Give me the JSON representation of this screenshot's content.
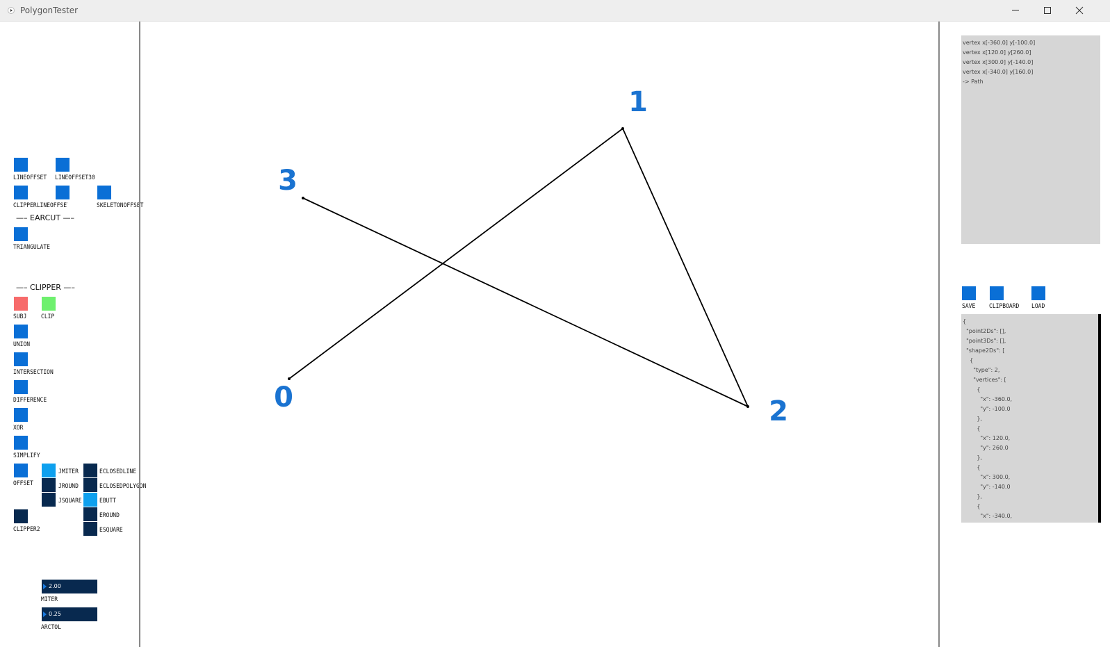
{
  "window": {
    "title": "PolygonTester"
  },
  "left": {
    "line_offset": "LINEOFFSET",
    "line_offset30": "LINEOFFSET30",
    "clipper_line_offset": "CLIPPERLINEOFFSET",
    "skeleton_offset": "SKELETONOFFSET",
    "earcut_header": "—– EARCUT —–",
    "triangulate": "TRIANGULATE",
    "clipper_header": "—– CLIPPER —–",
    "subj": "SUBJ",
    "clip": "CLIP",
    "union": "UNION",
    "intersection": "INTERSECTION",
    "difference": "DIFFERENCE",
    "xor": "XOR",
    "simplify": "SIMPLIFY",
    "offset": "OFFSET",
    "jmiter": "JMITER",
    "jround": "JROUND",
    "jsquare": "JSQUARE",
    "eclosedline": "ECLOSEDLINE",
    "eclosedpolygon": "ECLOSEDPOLYGON",
    "ebutt": "EBUTT",
    "eround": "EROUND",
    "esquare": "ESQUARE",
    "clipper2": "CLIPPER2",
    "miter_value": "2.00",
    "miter_label": "MITER",
    "arctol_value": "0.25",
    "arctol_label": "ARCTOL"
  },
  "canvas": {
    "vertex_labels": [
      "0",
      "1",
      "2",
      "3"
    ],
    "vertices": [
      {
        "x": -360.0,
        "y": -100.0
      },
      {
        "x": 120.0,
        "y": 260.0
      },
      {
        "x": 300.0,
        "y": -140.0
      },
      {
        "x": -340.0,
        "y": 160.0
      }
    ]
  },
  "right": {
    "log_lines": [
      "vertex x[-360.0] y[-100.0]",
      "vertex x[120.0] y[260.0]",
      "vertex x[300.0] y[-140.0]",
      "vertex x[-340.0] y[160.0]",
      "-> Path"
    ],
    "save": "SAVE",
    "clipboard": "CLIPBOARD",
    "load": "LOAD",
    "json_lines": [
      "{",
      "  \"point2Ds\": [],",
      "  \"point3Ds\": [],",
      "  \"shape2Ds\": [",
      "    {",
      "      \"type\": 2,",
      "      \"vertices\": [",
      "        {",
      "          \"x\": -360.0,",
      "          \"y\": -100.0",
      "        },",
      "        {",
      "          \"x\": 120.0,",
      "          \"y\": 260.0",
      "        },",
      "        {",
      "          \"x\": 300.0,",
      "          \"y\": -140.0",
      "        },",
      "        {",
      "          \"x\": -340.0,"
    ]
  },
  "colors": {
    "button_blue": "#0a6fd6",
    "subj_red": "#f76b6b",
    "clip_green": "#6ef06e",
    "dark_navy": "#08294f",
    "label_blue": "#1a73d1"
  }
}
